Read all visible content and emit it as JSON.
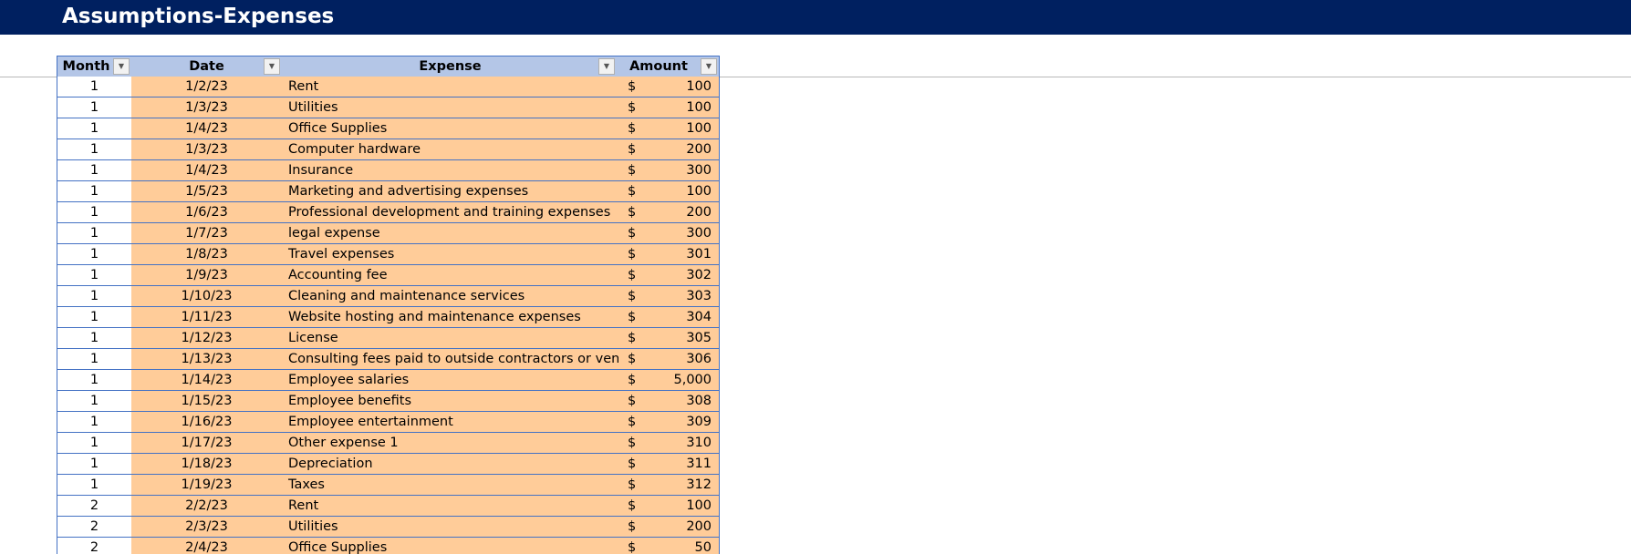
{
  "sheet": {
    "title": "Assumptions-Expenses"
  },
  "table": {
    "headers": {
      "month": "Month",
      "date": "Date",
      "expense": "Expense",
      "amount": "Amount"
    },
    "filter_icon": "filter-dropdown-icon",
    "currency_symbol": "$",
    "rows": [
      {
        "month": "1",
        "date": "1/2/23",
        "expense": "Rent",
        "amount": "100"
      },
      {
        "month": "1",
        "date": "1/3/23",
        "expense": "Utilities",
        "amount": "100"
      },
      {
        "month": "1",
        "date": "1/4/23",
        "expense": "Office Supplies",
        "amount": "100"
      },
      {
        "month": "1",
        "date": "1/3/23",
        "expense": "Computer hardware",
        "amount": "200"
      },
      {
        "month": "1",
        "date": "1/4/23",
        "expense": "Insurance",
        "amount": "300"
      },
      {
        "month": "1",
        "date": "1/5/23",
        "expense": "Marketing and advertising expenses",
        "amount": "100"
      },
      {
        "month": "1",
        "date": "1/6/23",
        "expense": "Professional development and training expenses",
        "amount": "200"
      },
      {
        "month": "1",
        "date": "1/7/23",
        "expense": "legal expense",
        "amount": "300"
      },
      {
        "month": "1",
        "date": "1/8/23",
        "expense": "Travel expenses",
        "amount": "301"
      },
      {
        "month": "1",
        "date": "1/9/23",
        "expense": "Accounting fee",
        "amount": "302"
      },
      {
        "month": "1",
        "date": "1/10/23",
        "expense": "Cleaning and maintenance services",
        "amount": "303"
      },
      {
        "month": "1",
        "date": "1/11/23",
        "expense": "Website hosting and maintenance expenses",
        "amount": "304"
      },
      {
        "month": "1",
        "date": "1/12/23",
        "expense": "License",
        "amount": "305"
      },
      {
        "month": "1",
        "date": "1/13/23",
        "expense": "Consulting fees paid to outside contractors or ven",
        "amount": "306"
      },
      {
        "month": "1",
        "date": "1/14/23",
        "expense": "Employee salaries",
        "amount": "5,000"
      },
      {
        "month": "1",
        "date": "1/15/23",
        "expense": "Employee benefits",
        "amount": "308"
      },
      {
        "month": "1",
        "date": "1/16/23",
        "expense": "Employee entertainment",
        "amount": "309"
      },
      {
        "month": "1",
        "date": "1/17/23",
        "expense": "Other expense 1",
        "amount": "310"
      },
      {
        "month": "1",
        "date": "1/18/23",
        "expense": "Depreciation",
        "amount": "311"
      },
      {
        "month": "1",
        "date": "1/19/23",
        "expense": "Taxes",
        "amount": "312"
      },
      {
        "month": "2",
        "date": "2/2/23",
        "expense": "Rent",
        "amount": "100"
      },
      {
        "month": "2",
        "date": "2/3/23",
        "expense": "Utilities",
        "amount": "200"
      },
      {
        "month": "2",
        "date": "2/4/23",
        "expense": "Office Supplies",
        "amount": "50"
      }
    ]
  },
  "colors": {
    "title_bar": "#002060",
    "header_fill": "#b4c6e7",
    "data_fill": "#ffcc99",
    "border": "#4472c4"
  }
}
